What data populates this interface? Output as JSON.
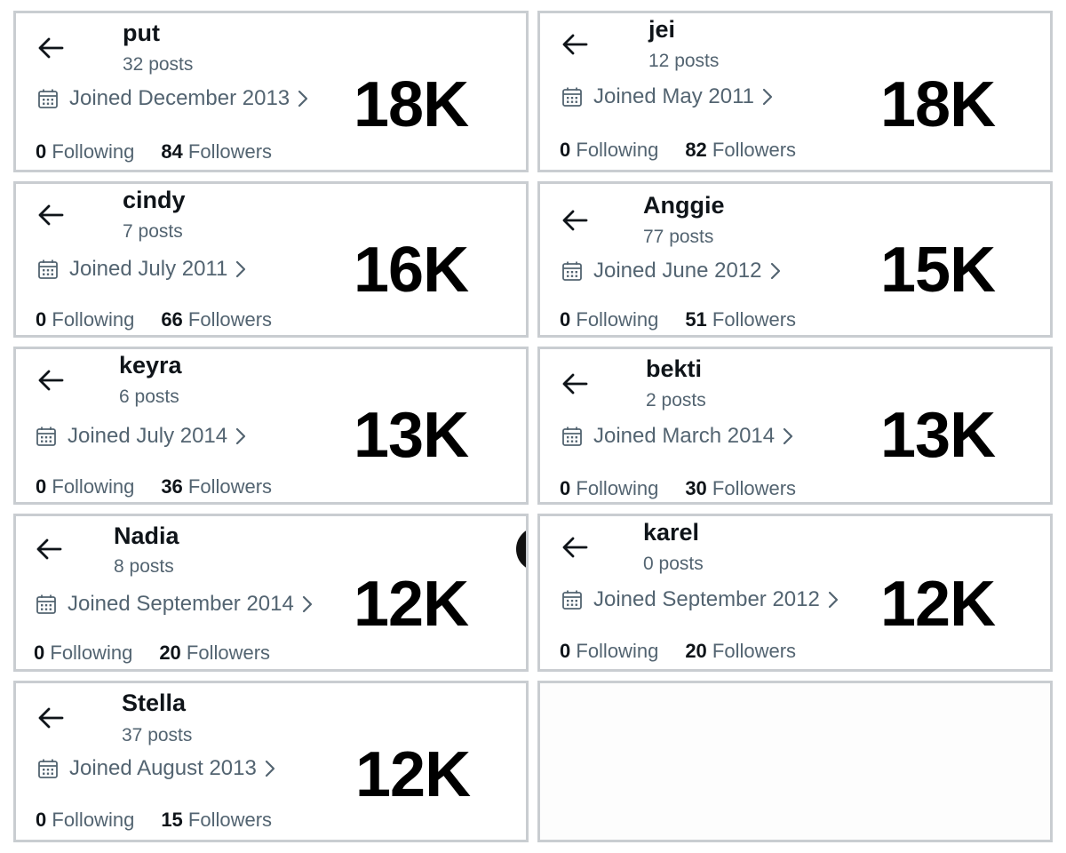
{
  "accent_colors": {
    "name": "#0f1419",
    "muted": "#536471",
    "big_count": "#000000",
    "border": "#c9cdd1"
  },
  "cards": [
    {
      "name": "put",
      "posts": "32 posts",
      "joined": "Joined December 2013",
      "following_count": "0",
      "following_label": "Following",
      "followers_count": "84",
      "followers_label": "Followers",
      "big_count": "18K"
    },
    {
      "name": "jei",
      "posts": "12 posts",
      "joined": "Joined May 2011",
      "following_count": "0",
      "following_label": "Following",
      "followers_count": "82",
      "followers_label": "Followers",
      "big_count": "18K"
    },
    {
      "name": "cindy",
      "posts": "7 posts",
      "joined": "Joined July 2011",
      "following_count": "0",
      "following_label": "Following",
      "followers_count": "66",
      "followers_label": "Followers",
      "big_count": "16K"
    },
    {
      "name": "Anggie",
      "posts": "77 posts",
      "joined": "Joined June 2012",
      "following_count": "0",
      "following_label": "Following",
      "followers_count": "51",
      "followers_label": "Followers",
      "big_count": "15K"
    },
    {
      "name": "keyra",
      "posts": "6 posts",
      "joined": "Joined July 2014",
      "following_count": "0",
      "following_label": "Following",
      "followers_count": "36",
      "followers_label": "Followers",
      "big_count": "13K"
    },
    {
      "name": "bekti",
      "posts": "2 posts",
      "joined": "Joined March 2014",
      "following_count": "0",
      "following_label": "Following",
      "followers_count": "30",
      "followers_label": "Followers",
      "big_count": "13K"
    },
    {
      "name": "Nadia",
      "posts": "8 posts",
      "joined": "Joined September 2014",
      "following_count": "0",
      "following_label": "Following",
      "followers_count": "20",
      "followers_label": "Followers",
      "big_count": "12K"
    },
    {
      "name": "karel",
      "posts": "0 posts",
      "joined": "Joined September 2012",
      "following_count": "0",
      "following_label": "Following",
      "followers_count": "20",
      "followers_label": "Followers",
      "big_count": "12K"
    },
    {
      "name": "Stella",
      "posts": "37 posts",
      "joined": "Joined August 2013",
      "following_count": "0",
      "following_label": "Following",
      "followers_count": "15",
      "followers_label": "Followers",
      "big_count": "12K"
    }
  ]
}
